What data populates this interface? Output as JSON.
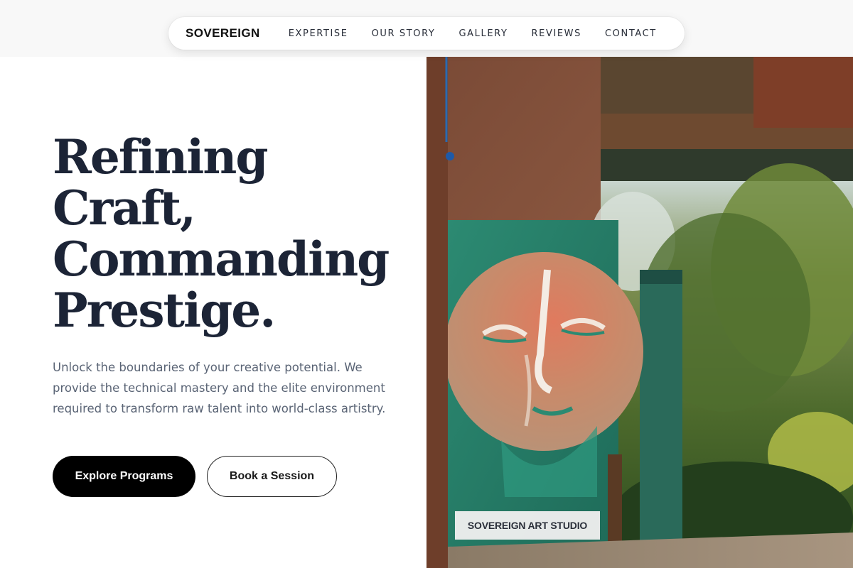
{
  "nav": {
    "brand": "SOVEREIGN",
    "links": [
      "EXPERTISE",
      "OUR STORY",
      "GALLERY",
      "REVIEWS",
      "CONTACT"
    ]
  },
  "hero": {
    "headline_lines": [
      "Refining",
      "Craft,",
      "Commanding",
      "Prestige."
    ],
    "lede": "Unlock the boundaries of your creative potential. We provide the technical mastery and the elite environment required to transform raw talent into world-class artistry.",
    "primary_cta": "Explore Programs",
    "secondary_cta": "Book a Session"
  },
  "image": {
    "caption": "SOVEREIGN ART STUDIO",
    "subject": "painted-face-artwork-photo"
  },
  "colors": {
    "headline": "#1c2436",
    "body_text": "#5a6475",
    "primary_button": "#000000",
    "top_band": "#f8f8f8"
  }
}
